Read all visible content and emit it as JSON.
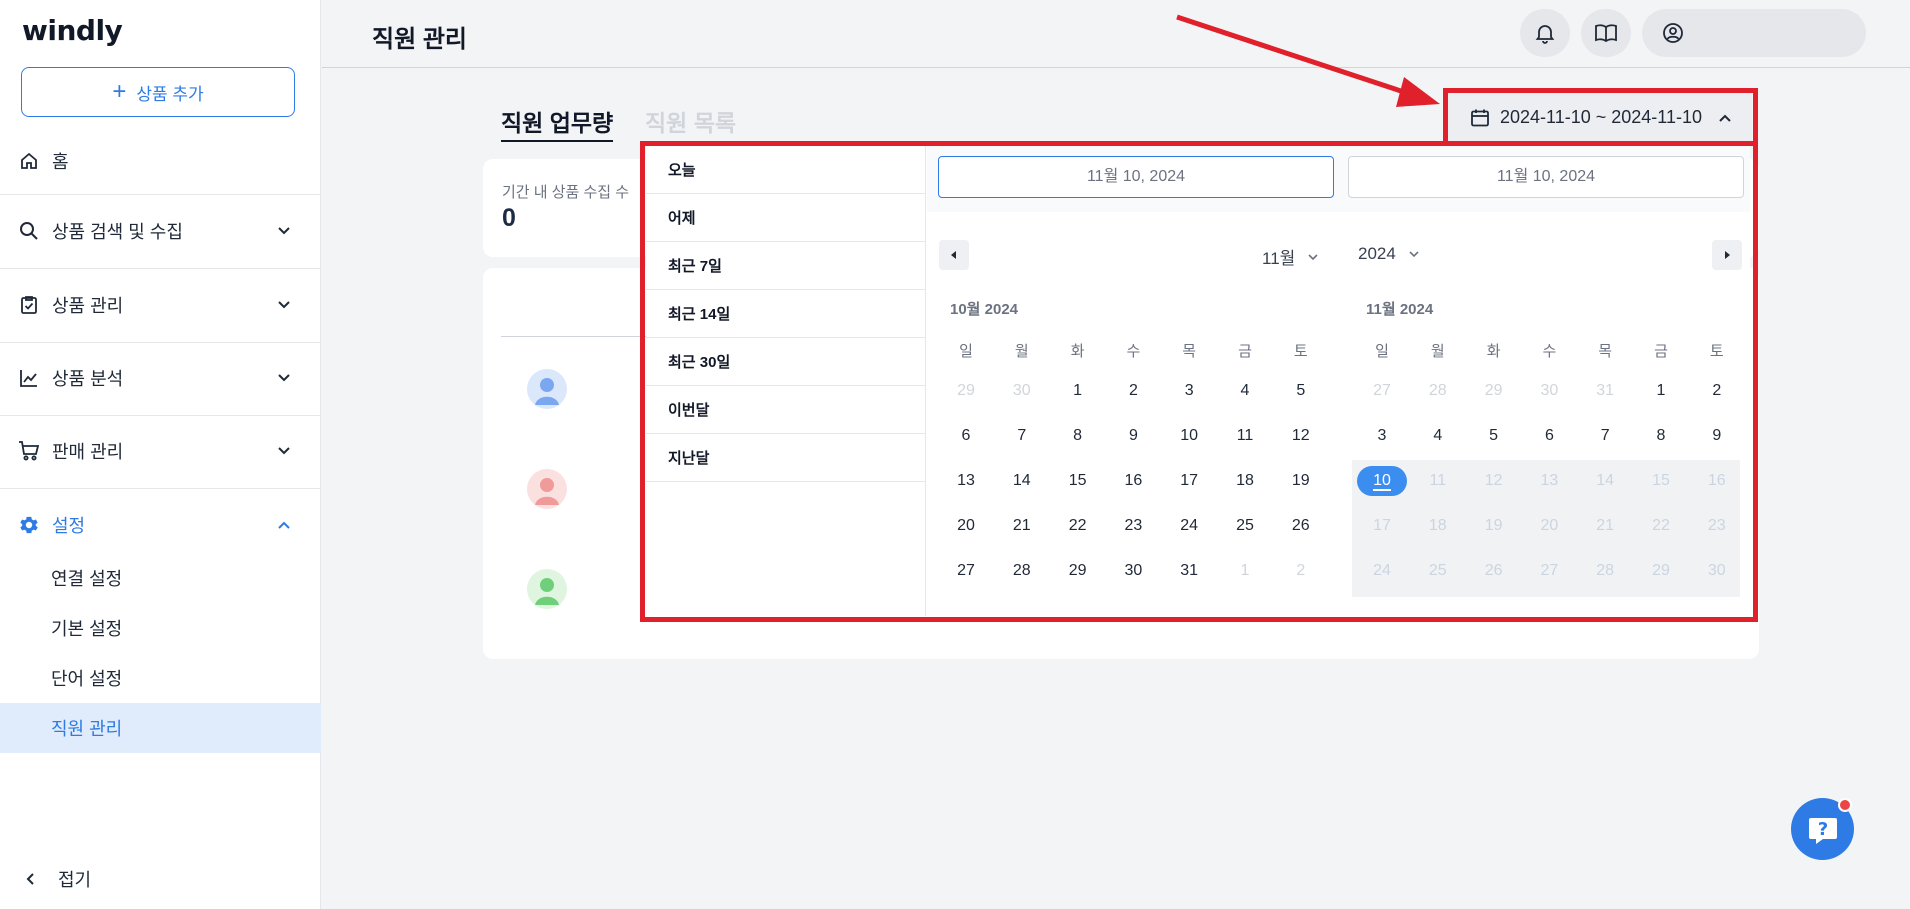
{
  "app": {
    "logo": "windly"
  },
  "sidebar": {
    "add_product": "상품 추가",
    "home": "홈",
    "items": [
      {
        "label": "상품 검색 및 수집",
        "icon": "search-icon"
      },
      {
        "label": "상품 관리",
        "icon": "clipboard-check-icon"
      },
      {
        "label": "상품 분석",
        "icon": "chart-line-icon"
      },
      {
        "label": "판매 관리",
        "icon": "cart-icon"
      },
      {
        "label": "설정",
        "icon": "gear-icon"
      }
    ],
    "sub_items": [
      "연결 설정",
      "기본 설정",
      "단어 설정",
      "직원 관리"
    ],
    "collapse": "접기"
  },
  "header": {
    "title": "직원 관리"
  },
  "tabs": [
    "직원 업무량",
    "직원 목록"
  ],
  "stat": {
    "label": "기간 내 상품 수집 수",
    "value": "0"
  },
  "date_range": {
    "label": "2024-11-10 ~ 2024-11-10"
  },
  "presets": [
    "오늘",
    "어제",
    "최근 7일",
    "최근 14일",
    "최근 30일",
    "이번달",
    "지난달"
  ],
  "inputs": {
    "start": "11월 10, 2024",
    "end": "11월 10, 2024"
  },
  "selectors": {
    "month": "11월",
    "year": "2024"
  },
  "weekdays": [
    "일",
    "월",
    "화",
    "수",
    "목",
    "금",
    "토"
  ],
  "calendars": [
    {
      "title": "10월 2024",
      "weeks": [
        [
          "29",
          "30",
          "1",
          "2",
          "3",
          "4",
          "5"
        ],
        [
          "6",
          "7",
          "8",
          "9",
          "10",
          "11",
          "12"
        ],
        [
          "13",
          "14",
          "15",
          "16",
          "17",
          "18",
          "19"
        ],
        [
          "20",
          "21",
          "22",
          "23",
          "24",
          "25",
          "26"
        ],
        [
          "27",
          "28",
          "29",
          "30",
          "31",
          "1",
          "2"
        ]
      ]
    },
    {
      "title": "11월 2024",
      "weeks": [
        [
          "27",
          "28",
          "29",
          "30",
          "31",
          "1",
          "2"
        ],
        [
          "3",
          "4",
          "5",
          "6",
          "7",
          "8",
          "9"
        ],
        [
          "10",
          "11",
          "12",
          "13",
          "14",
          "15",
          "16"
        ],
        [
          "17",
          "18",
          "19",
          "20",
          "21",
          "22",
          "23"
        ],
        [
          "24",
          "25",
          "26",
          "27",
          "28",
          "29",
          "30"
        ]
      ]
    }
  ],
  "colors": {
    "accent": "#2f7be5",
    "annotation": "#e0202a"
  }
}
